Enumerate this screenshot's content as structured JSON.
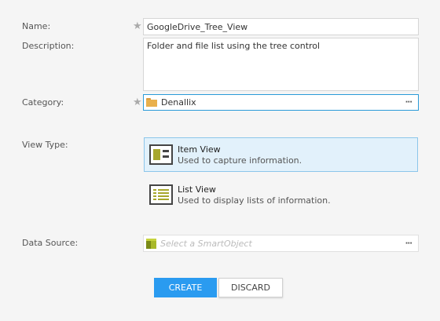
{
  "form": {
    "name": {
      "label": "Name:",
      "value": "GoogleDrive_Tree_View",
      "required": true
    },
    "description": {
      "label": "Description:",
      "value": "Folder and file list using the tree control"
    },
    "category": {
      "label": "Category:",
      "value": "Denallix",
      "required": true,
      "icon": "folder-icon",
      "browse_label": "···"
    },
    "view_type": {
      "label": "View Type:",
      "options": [
        {
          "title": "Item View",
          "subtitle": "Used to capture information.",
          "selected": true,
          "icon": "item-view-icon"
        },
        {
          "title": "List View",
          "subtitle": "Used to display lists of information.",
          "selected": false,
          "icon": "list-view-icon"
        }
      ]
    },
    "data_source": {
      "label": "Data Source:",
      "placeholder": "Select a SmartObject",
      "icon": "smartobject-icon",
      "browse_label": "···"
    }
  },
  "buttons": {
    "create": "CREATE",
    "discard": "DISCARD"
  },
  "colors": {
    "accent": "#2a9bf0",
    "selected_bg": "#e2f1fb",
    "background": "#f5f5f5"
  },
  "required_marker": "★"
}
